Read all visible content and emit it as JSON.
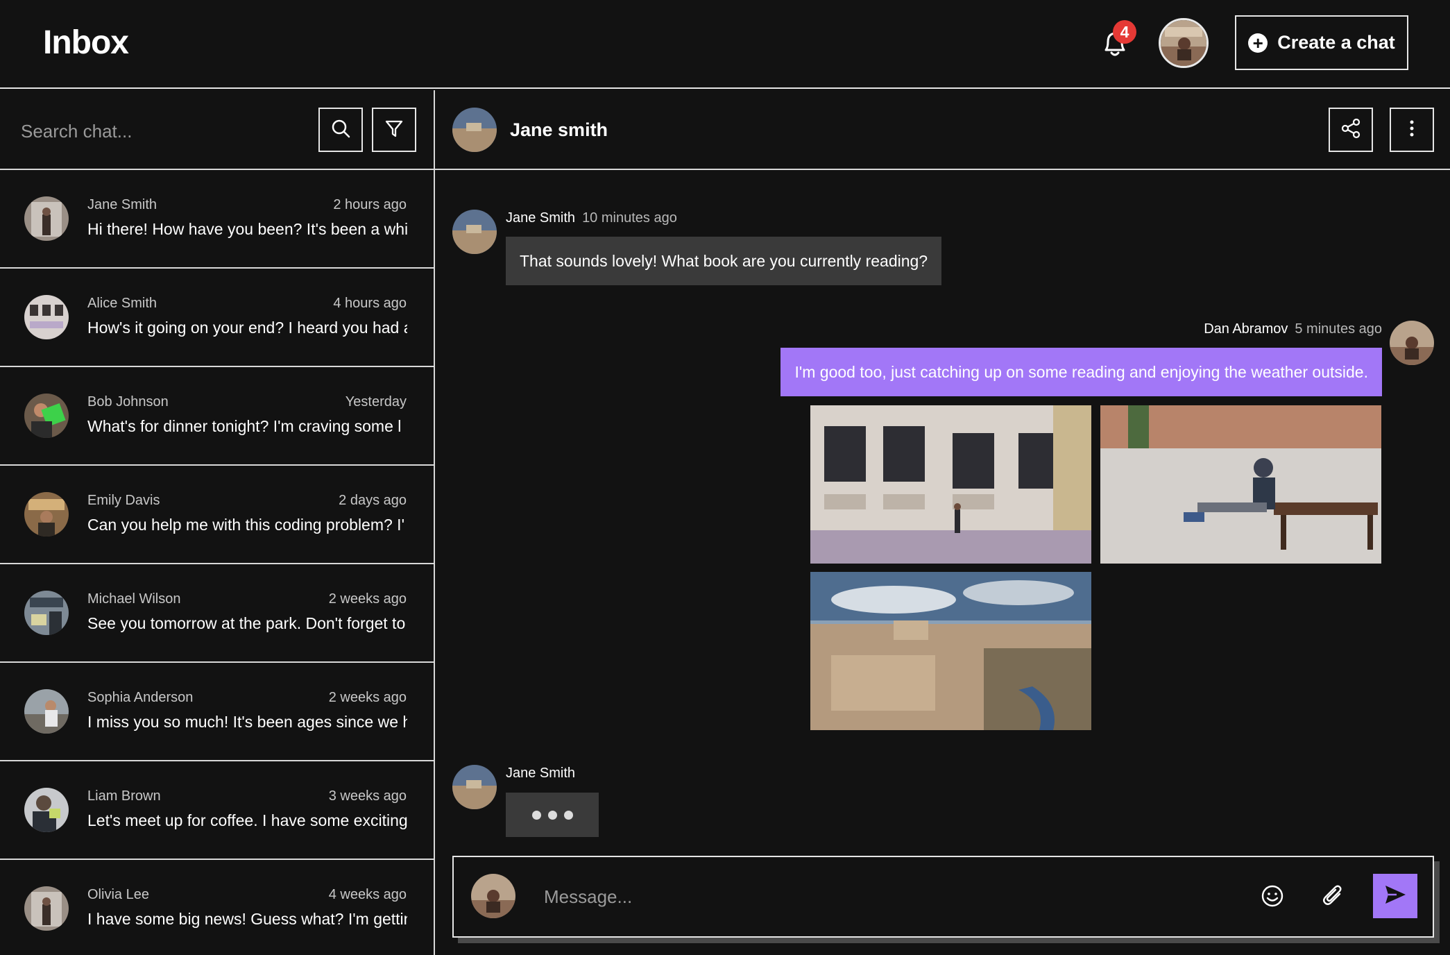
{
  "header": {
    "title": "Inbox",
    "notification_count": "4",
    "create_chat_label": "Create a chat"
  },
  "search": {
    "placeholder": "Search chat..."
  },
  "chats": [
    {
      "name": "Jane Smith",
      "time": "2 hours ago",
      "preview": "Hi there! How have you been? It's been a while"
    },
    {
      "name": "Alice Smith",
      "time": "4 hours ago",
      "preview": "How's it going on your end? I heard you had a"
    },
    {
      "name": "Bob Johnson",
      "time": "Yesterday",
      "preview": "What's for dinner tonight? I'm craving some l"
    },
    {
      "name": "Emily Davis",
      "time": "2 days ago",
      "preview": "Can you help me with this coding problem? I'"
    },
    {
      "name": "Michael Wilson",
      "time": "2 weeks ago",
      "preview": "See you tomorrow at the park. Don't forget to"
    },
    {
      "name": "Sophia Anderson",
      "time": "2 weeks ago",
      "preview": "I miss you so much! It's been ages since we h"
    },
    {
      "name": "Liam Brown",
      "time": "3 weeks ago",
      "preview": "Let's meet up for coffee. I have some exciting"
    },
    {
      "name": "Olivia Lee",
      "time": "4 weeks ago",
      "preview": "I have some big news! Guess what? I'm getting"
    }
  ],
  "conversation": {
    "title": "Jane smith",
    "messages": [
      {
        "sender": "Jane Smith",
        "time": "10 minutes ago",
        "text": "That sounds lovely! What book are you currently reading?"
      },
      {
        "sender": "Dan Abramov",
        "time": "5 minutes ago",
        "text": "I'm good too, just catching up on some reading and enjoying the weather outside."
      }
    ],
    "typing_sender": "Jane Smith"
  },
  "composer": {
    "placeholder": "Message..."
  },
  "colors": {
    "accent": "#a277f7",
    "badge": "#e53935",
    "background": "#121212",
    "bubble_in": "#3a3a3a"
  }
}
